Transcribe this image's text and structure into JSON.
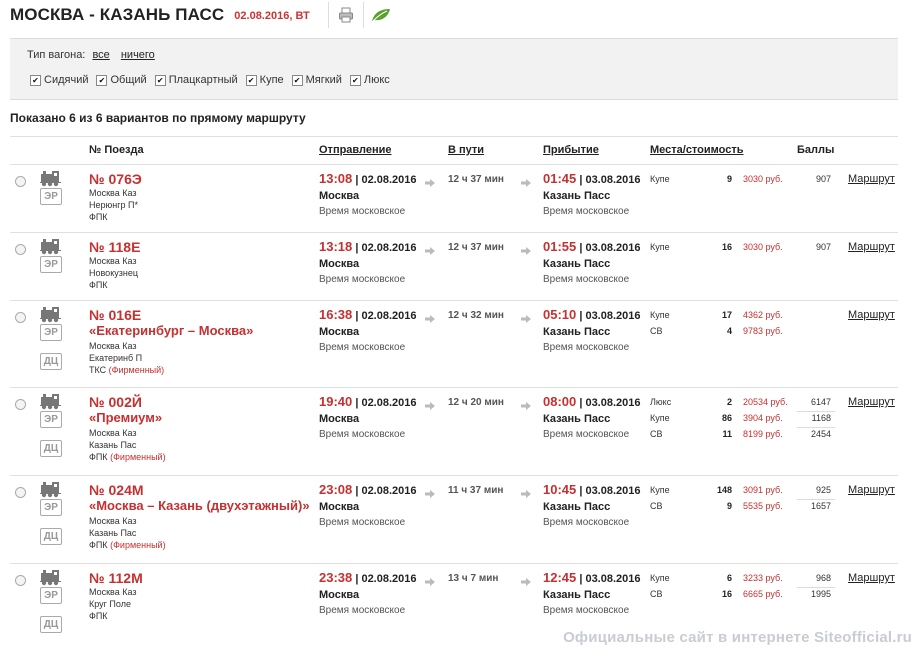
{
  "header": {
    "title": "МОСКВА - КАЗАНЬ ПАСС",
    "date": "02.08.2016, ВТ"
  },
  "filter": {
    "label": "Тип вагона:",
    "all": "все",
    "none": "ничего",
    "types": [
      "Сидячий",
      "Общий",
      "Плацкартный",
      "Купе",
      "Мягкий",
      "Люкс"
    ]
  },
  "shown_text": "Показано 6 из 6 вариантов по прямому маршруту",
  "columns": {
    "train": "№ Поезда",
    "departure": "Отправление",
    "duration": "В пути",
    "arrival": "Прибытие",
    "seats": "Места/стоимость",
    "score": "Баллы"
  },
  "badges": {
    "er": "ЭР",
    "dc": "ДЦ"
  },
  "timezone": "Время московское",
  "route_link": "Маршрут",
  "brand_label": "(Фирменный)",
  "trains": [
    {
      "number": "№ 076Э",
      "name": "",
      "route_from": "Москва Каз",
      "route_to": "Нерюнгр П*",
      "carrier": "ФПК",
      "brand": "",
      "dep_time": "13:08",
      "dep_date": "| 02.08.2016",
      "dep_station": "Москва",
      "duration": "12 ч 37 мин",
      "arr_time": "01:45",
      "arr_date": "| 03.08.2016",
      "arr_station": "Казань Пасс",
      "seats": [
        {
          "type": "Купе",
          "count": "9",
          "price": "3030 руб.",
          "score": "907"
        }
      ],
      "route": "Маршрут",
      "dc": false
    },
    {
      "number": "№ 118Е",
      "name": "",
      "route_from": "Москва Каз",
      "route_to": "Новокузнец",
      "carrier": "ФПК",
      "brand": "",
      "dep_time": "13:18",
      "dep_date": "| 02.08.2016",
      "dep_station": "Москва",
      "duration": "12 ч 37 мин",
      "arr_time": "01:55",
      "arr_date": "| 03.08.2016",
      "arr_station": "Казань Пасс",
      "seats": [
        {
          "type": "Купе",
          "count": "16",
          "price": "3030 руб.",
          "score": "907"
        }
      ],
      "route": "Маршрут",
      "dc": false
    },
    {
      "number": "№ 016Е",
      "name": "«Екатеринбург – Москва»",
      "route_from": "Москва Каз",
      "route_to": "Екатеринб П",
      "carrier": "ТКС",
      "brand": "(Фирменный)",
      "dep_time": "16:38",
      "dep_date": "| 02.08.2016",
      "dep_station": "Москва",
      "duration": "12 ч 32 мин",
      "arr_time": "05:10",
      "arr_date": "| 03.08.2016",
      "arr_station": "Казань Пасс",
      "seats": [
        {
          "type": "Купе",
          "count": "17",
          "price": "4362 руб.",
          "score": ""
        },
        {
          "type": "СВ",
          "count": "4",
          "price": "9783 руб.",
          "score": ""
        }
      ],
      "route": "Маршрут",
      "dc": true
    },
    {
      "number": "№ 002Й",
      "name": "«Премиум»",
      "route_from": "Москва Каз",
      "route_to": "Казань Пас",
      "carrier": "ФПК",
      "brand": "(Фирменный)",
      "dep_time": "19:40",
      "dep_date": "| 02.08.2016",
      "dep_station": "Москва",
      "duration": "12 ч 20 мин",
      "arr_time": "08:00",
      "arr_date": "| 03.08.2016",
      "arr_station": "Казань Пасс",
      "seats": [
        {
          "type": "Люкс",
          "count": "2",
          "price": "20534 руб.",
          "score": "6147"
        },
        {
          "type": "Купе",
          "count": "86",
          "price": "3904 руб.",
          "score": "1168"
        },
        {
          "type": "СВ",
          "count": "11",
          "price": "8199 руб.",
          "score": "2454"
        }
      ],
      "route": "Маршрут",
      "dc": true
    },
    {
      "number": "№ 024М",
      "name": "«Москва – Казань (двухэтажный)»",
      "route_from": "Москва Каз",
      "route_to": "Казань Пас",
      "carrier": "ФПК",
      "brand": "(Фирменный)",
      "dep_time": "23:08",
      "dep_date": "| 02.08.2016",
      "dep_station": "Москва",
      "duration": "11 ч 37 мин",
      "arr_time": "10:45",
      "arr_date": "| 03.08.2016",
      "arr_station": "Казань Пасс",
      "seats": [
        {
          "type": "Купе",
          "count": "148",
          "price": "3091 руб.",
          "score": "925"
        },
        {
          "type": "СВ",
          "count": "9",
          "price": "5535 руб.",
          "score": "1657"
        }
      ],
      "route": "Маршрут",
      "dc": true
    },
    {
      "number": "№ 112М",
      "name": "",
      "route_from": "Москва Каз",
      "route_to": "Круг Поле",
      "carrier": "ФПК",
      "brand": "",
      "dep_time": "23:38",
      "dep_date": "| 02.08.2016",
      "dep_station": "Москва",
      "duration": "13 ч 7 мин",
      "arr_time": "12:45",
      "arr_date": "| 03.08.2016",
      "arr_station": "Казань Пасс",
      "seats": [
        {
          "type": "Купе",
          "count": "6",
          "price": "3233 руб.",
          "score": "968"
        },
        {
          "type": "СВ",
          "count": "16",
          "price": "6665 руб.",
          "score": "1995"
        }
      ],
      "route": "Маршрут",
      "dc": true
    }
  ],
  "watermark": "Официальные сайт в интернете Siteofficial.ru",
  "colors": {
    "accent": "#c53030",
    "filter_bg": "#f2f2f2"
  },
  "icons": [
    "print-icon",
    "leaf-icon",
    "train-icon",
    "arrow-right-icon",
    "radio-icon"
  ]
}
